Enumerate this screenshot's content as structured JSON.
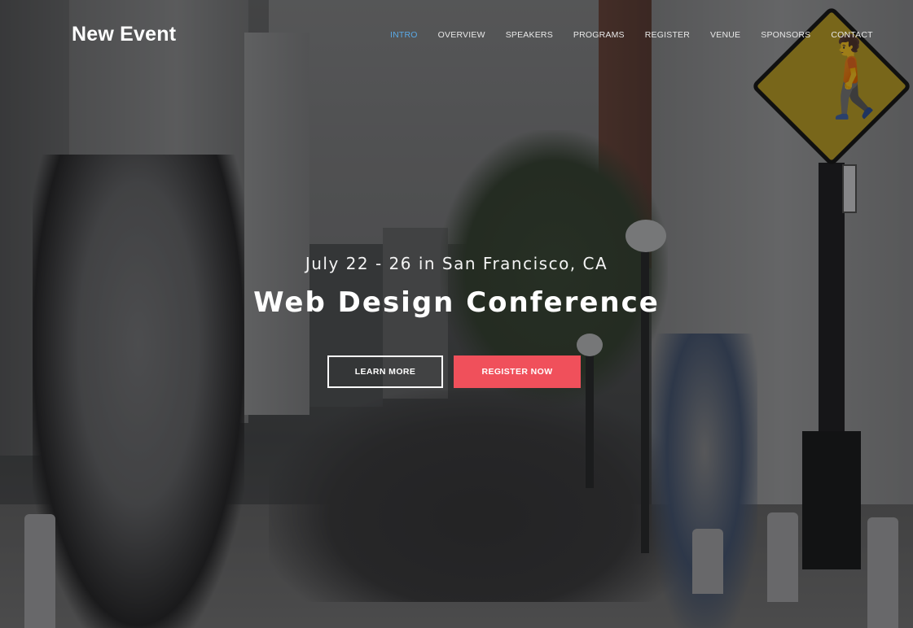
{
  "header": {
    "logo": "New Event",
    "nav": [
      {
        "label": "INTRO",
        "active": true
      },
      {
        "label": "OVERVIEW",
        "active": false
      },
      {
        "label": "SPEAKERS",
        "active": false
      },
      {
        "label": "PROGRAMS",
        "active": false
      },
      {
        "label": "REGISTER",
        "active": false
      },
      {
        "label": "VENUE",
        "active": false
      },
      {
        "label": "SPONSORS",
        "active": false
      },
      {
        "label": "CONTACT",
        "active": false
      }
    ]
  },
  "hero": {
    "subtitle": "July 22 - 26 in San Francisco, CA",
    "title": "Web Design Conference",
    "learn_more": "LEARN MORE",
    "register_now": "REGISTER NOW",
    "background": "city street crowd photo",
    "sign_icon": "pedestrian-crossing-icon"
  },
  "colors": {
    "accent": "#5aa9e6",
    "cta": "#f0505b",
    "text": "#ffffff"
  }
}
